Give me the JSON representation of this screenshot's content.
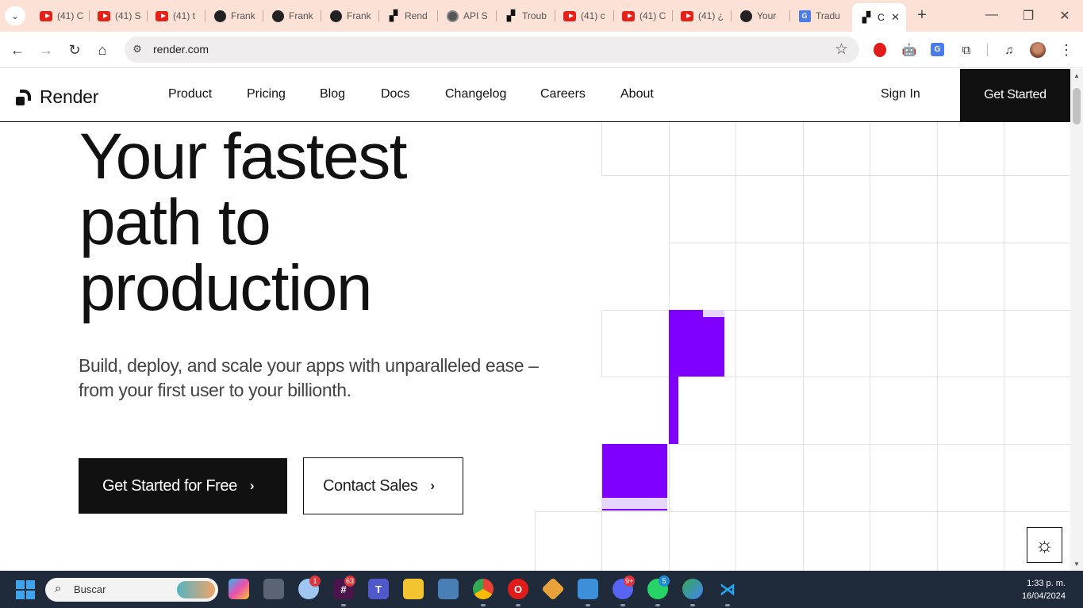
{
  "browser": {
    "tabs": [
      {
        "icon": "youtube-icon",
        "title": "(41) C"
      },
      {
        "icon": "youtube-icon",
        "title": "(41) S"
      },
      {
        "icon": "youtube-icon",
        "title": "(41) t"
      },
      {
        "icon": "github-icon",
        "title": "Frank"
      },
      {
        "icon": "github-icon",
        "title": "Frank"
      },
      {
        "icon": "github-icon",
        "title": "Frank"
      },
      {
        "icon": "render-icon",
        "title": "Rend"
      },
      {
        "icon": "globe-icon",
        "title": "API S"
      },
      {
        "icon": "render-icon",
        "title": "Troub"
      },
      {
        "icon": "youtube-icon",
        "title": "(41) c"
      },
      {
        "icon": "youtube-icon",
        "title": "(41) C"
      },
      {
        "icon": "youtube-icon",
        "title": "(41) ¿"
      },
      {
        "icon": "github-icon",
        "title": "Your"
      },
      {
        "icon": "google-translate-icon",
        "title": "Tradu"
      },
      {
        "icon": "render-icon",
        "title": "C",
        "active": true
      }
    ],
    "new_tab_label": "+",
    "url": "render.com"
  },
  "site": {
    "logo_text": "Render",
    "nav": [
      "Product",
      "Pricing",
      "Blog",
      "Docs",
      "Changelog",
      "Careers",
      "About"
    ],
    "sign_in": "Sign In",
    "get_started": "Get Started"
  },
  "hero": {
    "title_lines": [
      "Your fastest",
      "path to",
      "production"
    ],
    "subtitle": "Build, deploy, and scale your apps with unparalleled ease – from your first user to your billionth.",
    "cta_primary": "Get Started for Free",
    "cta_secondary": "Contact Sales"
  },
  "colors": {
    "accent_purple": "#8000ff",
    "accent_purple_light": "#e6d6ff",
    "grid_line": "#e2e2e2",
    "dark": "#111111",
    "tabstrip_bg": "#fbe1d6",
    "taskbar_bg": "#1f2b3b"
  },
  "taskbar": {
    "search_placeholder": "Buscar",
    "apps": [
      {
        "name": "copilot-icon",
        "badge": ""
      },
      {
        "name": "task-view-icon",
        "badge": ""
      },
      {
        "name": "onedrive-icon",
        "badge": "1"
      },
      {
        "name": "slack-icon",
        "badge": "63"
      },
      {
        "name": "teams-icon",
        "badge": ""
      },
      {
        "name": "file-explorer-icon",
        "badge": ""
      },
      {
        "name": "photos-icon",
        "badge": ""
      },
      {
        "name": "chrome-icon",
        "badge": ""
      },
      {
        "name": "opera-icon",
        "badge": ""
      },
      {
        "name": "git-icon",
        "badge": ""
      },
      {
        "name": "notepad-icon",
        "badge": ""
      },
      {
        "name": "discord-icon",
        "badge": "9+"
      },
      {
        "name": "whatsapp-icon",
        "badge": "5"
      },
      {
        "name": "maps-icon",
        "badge": ""
      },
      {
        "name": "vscode-icon",
        "badge": ""
      }
    ],
    "time": "1:33 p. m.",
    "date": "16/04/2024"
  }
}
